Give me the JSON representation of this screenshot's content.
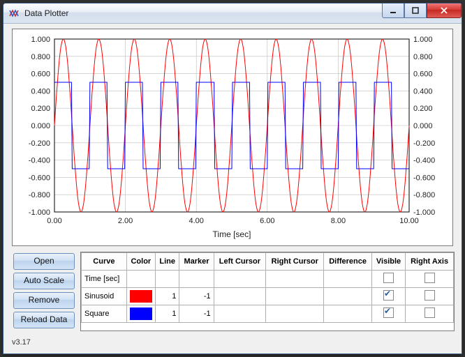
{
  "window": {
    "title": "Data Plotter",
    "version": "v3.17"
  },
  "buttons": {
    "open": "Open",
    "autoscale": "Auto Scale",
    "remove": "Remove",
    "reload": "Reload Data"
  },
  "table": {
    "headers": {
      "curve": "Curve",
      "color": "Color",
      "line": "Line",
      "marker": "Marker",
      "lcursor": "Left Cursor",
      "rcursor": "Right Cursor",
      "diff": "Difference",
      "visible": "Visible",
      "raxis": "Right Axis"
    },
    "rows": [
      {
        "name": "Time [sec]",
        "color": "",
        "line": "",
        "marker": "",
        "visible": false,
        "rightaxis": false,
        "color_show": false
      },
      {
        "name": "Sinusoid",
        "color": "#ff0000",
        "line": "1",
        "marker": "-1",
        "visible": true,
        "rightaxis": false,
        "color_show": true
      },
      {
        "name": "Square",
        "color": "#0000ff",
        "line": "1",
        "marker": "-1",
        "visible": true,
        "rightaxis": false,
        "color_show": true
      }
    ]
  },
  "chart_data": {
    "type": "line",
    "title": "",
    "xlabel": "Time [sec]",
    "ylabel": "",
    "xlim": [
      0,
      10
    ],
    "ylim_left": [
      -1.0,
      1.0
    ],
    "ylim_right": [
      -1.0,
      1.0
    ],
    "xticks": [
      0.0,
      2.0,
      4.0,
      6.0,
      8.0,
      10.0
    ],
    "yticks": [
      -1.0,
      -0.8,
      -0.6,
      -0.4,
      -0.2,
      0.0,
      0.2,
      0.4,
      0.6,
      0.8,
      1.0
    ],
    "ytick_labels": [
      "-1.000",
      "-0.800",
      "-0.600",
      "-0.400",
      "-0.200",
      "0.000",
      "0.200",
      "0.400",
      "0.600",
      "0.800",
      "1.000"
    ],
    "series": [
      {
        "name": "Sinusoid",
        "color": "#ff0000",
        "function": "sin(2*pi*x)",
        "amplitude": 1.0,
        "period": 1.0,
        "x_range": [
          0,
          10
        ],
        "dx": 0.02
      },
      {
        "name": "Square",
        "color": "#0000ff",
        "function": "0.5*square(2*pi*x)",
        "amplitude": 0.5,
        "period": 1.0,
        "x_range": [
          0,
          10
        ],
        "dx": 0.02
      }
    ]
  }
}
